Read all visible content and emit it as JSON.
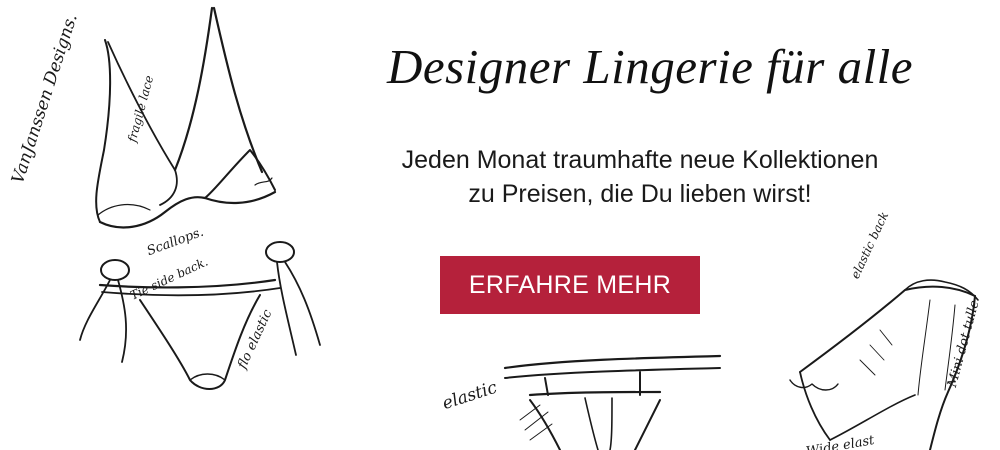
{
  "banner": {
    "headline": "Designer Lingerie für alle",
    "subline_1": "Jeden Monat traumhafte neue Kollektionen",
    "subline_2": "zu Preisen, die Du lieben wirst!",
    "cta_label": "ERFAHRE MEHR",
    "accent_color": "#b5213b"
  },
  "sketch_notes": {
    "signature": "VanJanssen Designs.",
    "bra_note": "fragile lace",
    "scallop_note": "Scallops.",
    "tie_note": "Tie side back.",
    "elastic_note_1": "flo elastic",
    "elastic_note_2": "elastic",
    "elastic_back_note": "elastic back",
    "mini_tulle_note": "Mini dot tulle",
    "wide_note": "Wide elast"
  }
}
